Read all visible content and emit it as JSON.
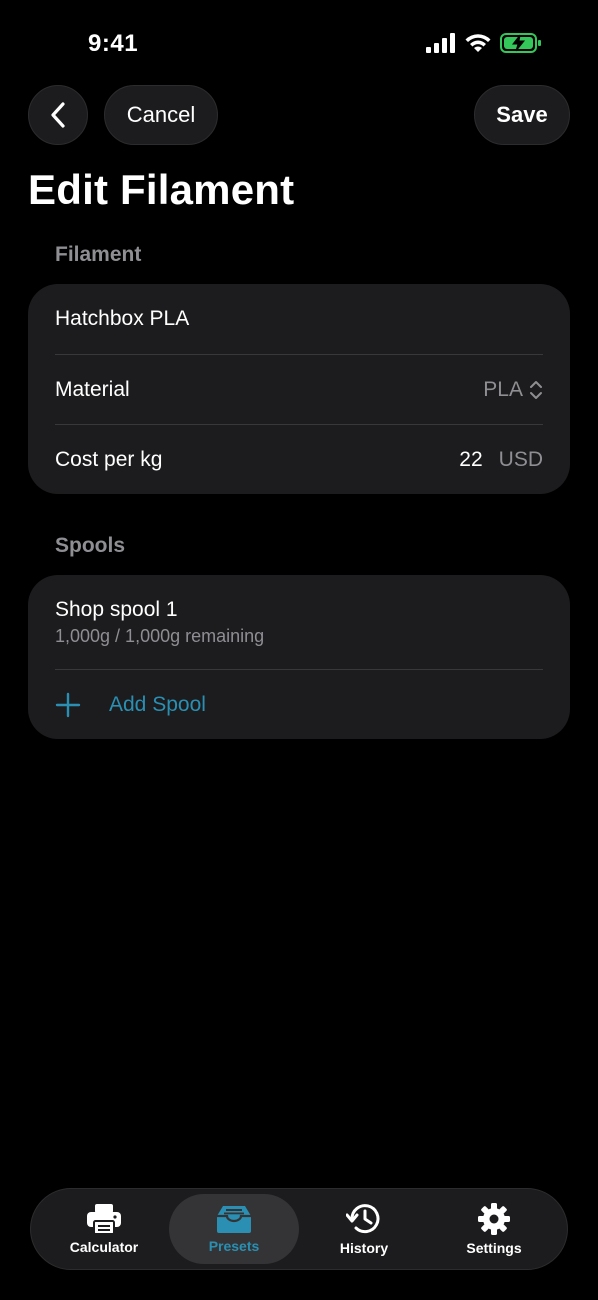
{
  "status": {
    "time": "9:41"
  },
  "nav": {
    "cancel_label": "Cancel",
    "save_label": "Save"
  },
  "page": {
    "title": "Edit Filament"
  },
  "filament": {
    "section_label": "Filament",
    "name": "Hatchbox PLA",
    "material_label": "Material",
    "material_value": "PLA",
    "cost_label": "Cost per kg",
    "cost_value": "22",
    "cost_unit": "USD"
  },
  "spools": {
    "section_label": "Spools",
    "items": [
      {
        "name": "Shop spool 1",
        "detail": "1,000g / 1,000g remaining"
      }
    ],
    "add_label": "Add Spool"
  },
  "tabs": [
    {
      "label": "Calculator",
      "icon": "printer-icon",
      "active": false
    },
    {
      "label": "Presets",
      "icon": "tray-icon",
      "active": true
    },
    {
      "label": "History",
      "icon": "history-icon",
      "active": false
    },
    {
      "label": "Settings",
      "icon": "gear-icon",
      "active": false
    }
  ],
  "colors": {
    "accent": "#2a8fb2",
    "card": "#1c1c1e",
    "secondary_text": "#8e8e93",
    "battery": "#34c759"
  }
}
